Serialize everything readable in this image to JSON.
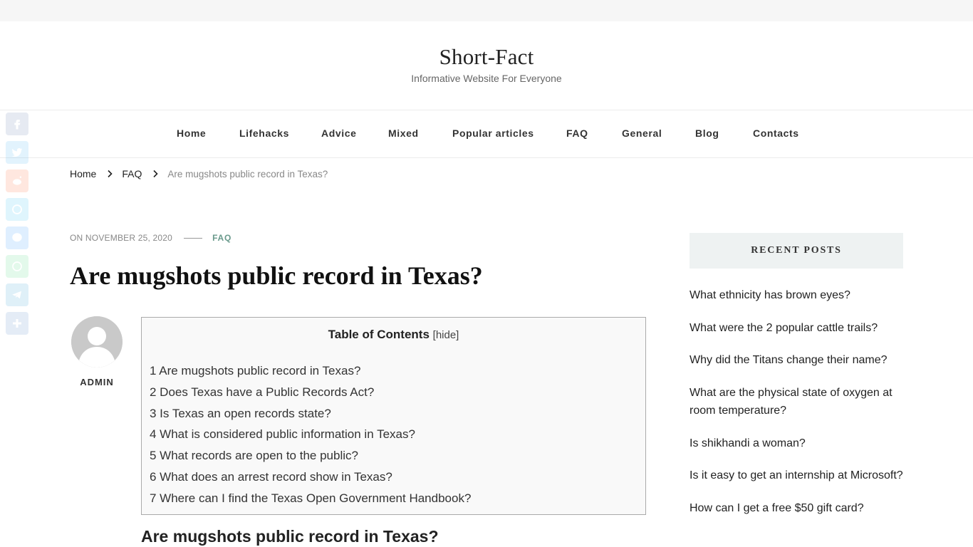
{
  "site": {
    "title": "Short-Fact",
    "tagline": "Informative Website For Everyone"
  },
  "nav": {
    "items": [
      {
        "label": "Home"
      },
      {
        "label": "Lifehacks"
      },
      {
        "label": "Advice"
      },
      {
        "label": "Mixed"
      },
      {
        "label": "Popular articles"
      },
      {
        "label": "FAQ"
      },
      {
        "label": "General"
      },
      {
        "label": "Blog"
      },
      {
        "label": "Contacts"
      }
    ]
  },
  "share": {
    "icons": [
      "facebook-icon",
      "twitter-icon",
      "reddit-icon",
      "skype-icon",
      "messenger-icon",
      "whatsapp-icon",
      "telegram-icon",
      "share-icon"
    ],
    "colors": {
      "facebook": "#3b5998",
      "twitter": "#1da1f2",
      "reddit": "#ff4500",
      "skype": "#00aff0",
      "messenger": "#0084ff",
      "whatsapp": "#25d366",
      "telegram": "#0088cc",
      "share": "#2a6ebb"
    }
  },
  "breadcrumb": {
    "home": "Home",
    "category": "FAQ",
    "current": "Are mugshots public record in Texas?"
  },
  "post": {
    "date": "ON NOVEMBER 25, 2020",
    "category": "FAQ",
    "title": "Are mugshots public record in Texas?",
    "author": "ADMIN"
  },
  "toc": {
    "title": "Table of Contents",
    "toggle": "[hide]",
    "items": [
      "1 Are mugshots public record in Texas?",
      "2 Does Texas have a Public Records Act?",
      "3 Is Texas an open records state?",
      "4 What is considered public information in Texas?",
      "5 What records are open to the public?",
      "6 What does an arrest record show in Texas?",
      "7 Where can I find the Texas Open Government Handbook?"
    ]
  },
  "content": {
    "first_heading": "Are mugshots public record in Texas?"
  },
  "sidebar": {
    "widget_title": "RECENT POSTS",
    "recent_posts": [
      "What ethnicity has brown eyes?",
      "What were the 2 popular cattle trails?",
      "Why did the Titans change their name?",
      "What are the physical state of oxygen at room temperature?",
      "Is shikhandi a woman?",
      "Is it easy to get an internship at Microsoft?",
      "How can I get a free $50 gift card?"
    ]
  },
  "colors": {
    "accent": "#6a9a8c",
    "widget_bg": "#eef2f2",
    "toc_bg": "#f9f9f9"
  }
}
